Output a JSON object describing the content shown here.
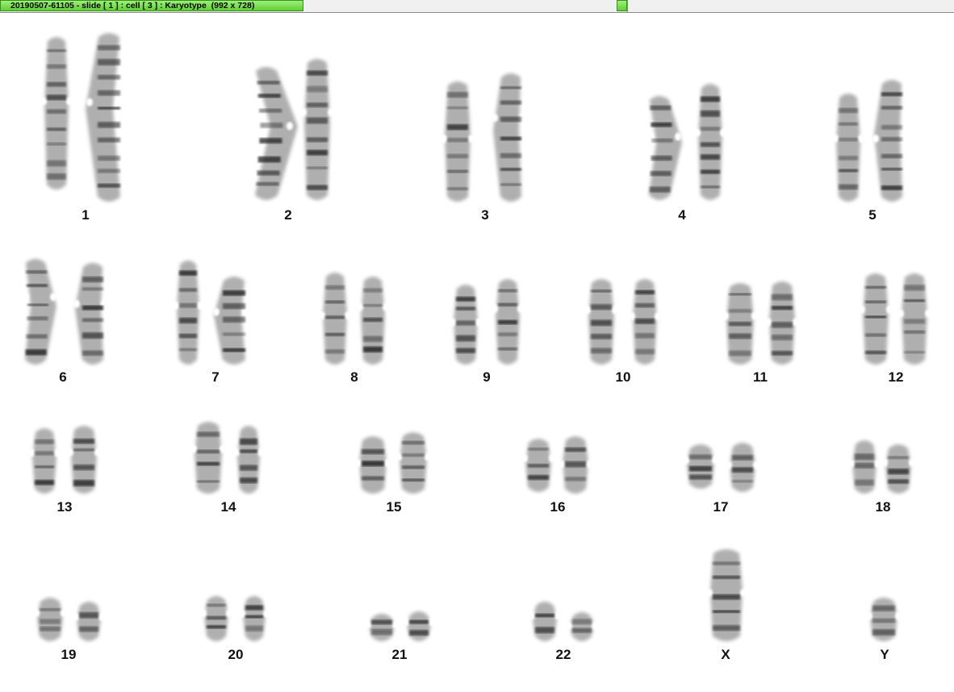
{
  "window": {
    "title": "20190507-61105 - slide [ 1 ] : cell [ 3 ] : Karyotype  (992 x 728)"
  },
  "karyotype": {
    "chromosome_labels": [
      "1",
      "2",
      "3",
      "4",
      "5",
      "6",
      "7",
      "8",
      "9",
      "10",
      "11",
      "12",
      "13",
      "14",
      "15",
      "16",
      "17",
      "18",
      "19",
      "20",
      "21",
      "22",
      "X",
      "Y"
    ]
  },
  "colors": {
    "title_tab": "#6fdc45",
    "background": "#ffffff",
    "chromosome": "#6e6e6e",
    "band": "#1e1e1e"
  }
}
